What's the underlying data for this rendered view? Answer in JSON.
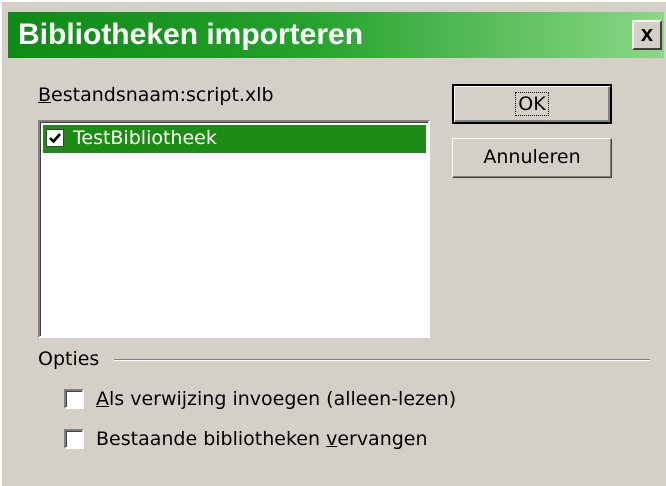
{
  "dialog": {
    "title": "Bibliotheken importeren",
    "close_label": "x"
  },
  "filename": {
    "label_accesskey": "B",
    "label_rest": "estandsnaam:",
    "value": "script.xlb"
  },
  "library_list": {
    "items": [
      {
        "label": "TestBibliotheek",
        "checked": true,
        "selected": true
      }
    ]
  },
  "buttons": {
    "ok_label": "OK",
    "cancel_label": "Annuleren"
  },
  "options": {
    "section_label": "Opties",
    "items": [
      {
        "accesskey": "A",
        "rest": "ls verwijzing invoegen (alleen-lezen)",
        "checked": false
      },
      {
        "pre": "Bestaande bibliotheken ",
        "accesskey": "v",
        "post": "ervangen",
        "checked": false
      }
    ]
  },
  "colors": {
    "title_gradient_start": "#0e8a16",
    "title_gradient_end": "#8bd786",
    "selection": "#1c8c14",
    "dialog_bg": "#d4d0c8"
  }
}
